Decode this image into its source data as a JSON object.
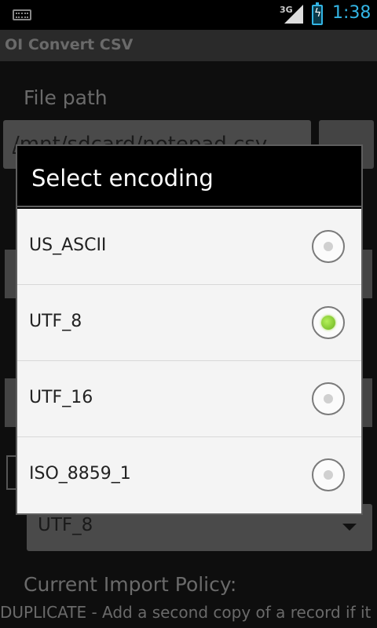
{
  "status_bar": {
    "network": "3G",
    "time": "1:38",
    "icons": [
      "keyboard-icon",
      "signal-icon",
      "battery-charging-icon"
    ]
  },
  "app": {
    "title": "OI Convert CSV"
  },
  "form": {
    "file_path_label": "File path",
    "file_path_value": "/mnt/sdcard/notepad.csv",
    "encoding_value": "UTF_8",
    "import_policy_label": "Current Import Policy:",
    "import_policy_desc": "DUPLICATE - Add a second copy of a record if it"
  },
  "dialog": {
    "title": "Select encoding",
    "options": [
      {
        "label": "US_ASCII",
        "selected": false
      },
      {
        "label": "UTF_8",
        "selected": true
      },
      {
        "label": "UTF_16",
        "selected": false
      },
      {
        "label": "ISO_8859_1",
        "selected": false
      }
    ]
  },
  "colors": {
    "accent": "#33b5e5",
    "radio_selected": "#8fd43a",
    "dialog_border": "#5e5e5e"
  }
}
